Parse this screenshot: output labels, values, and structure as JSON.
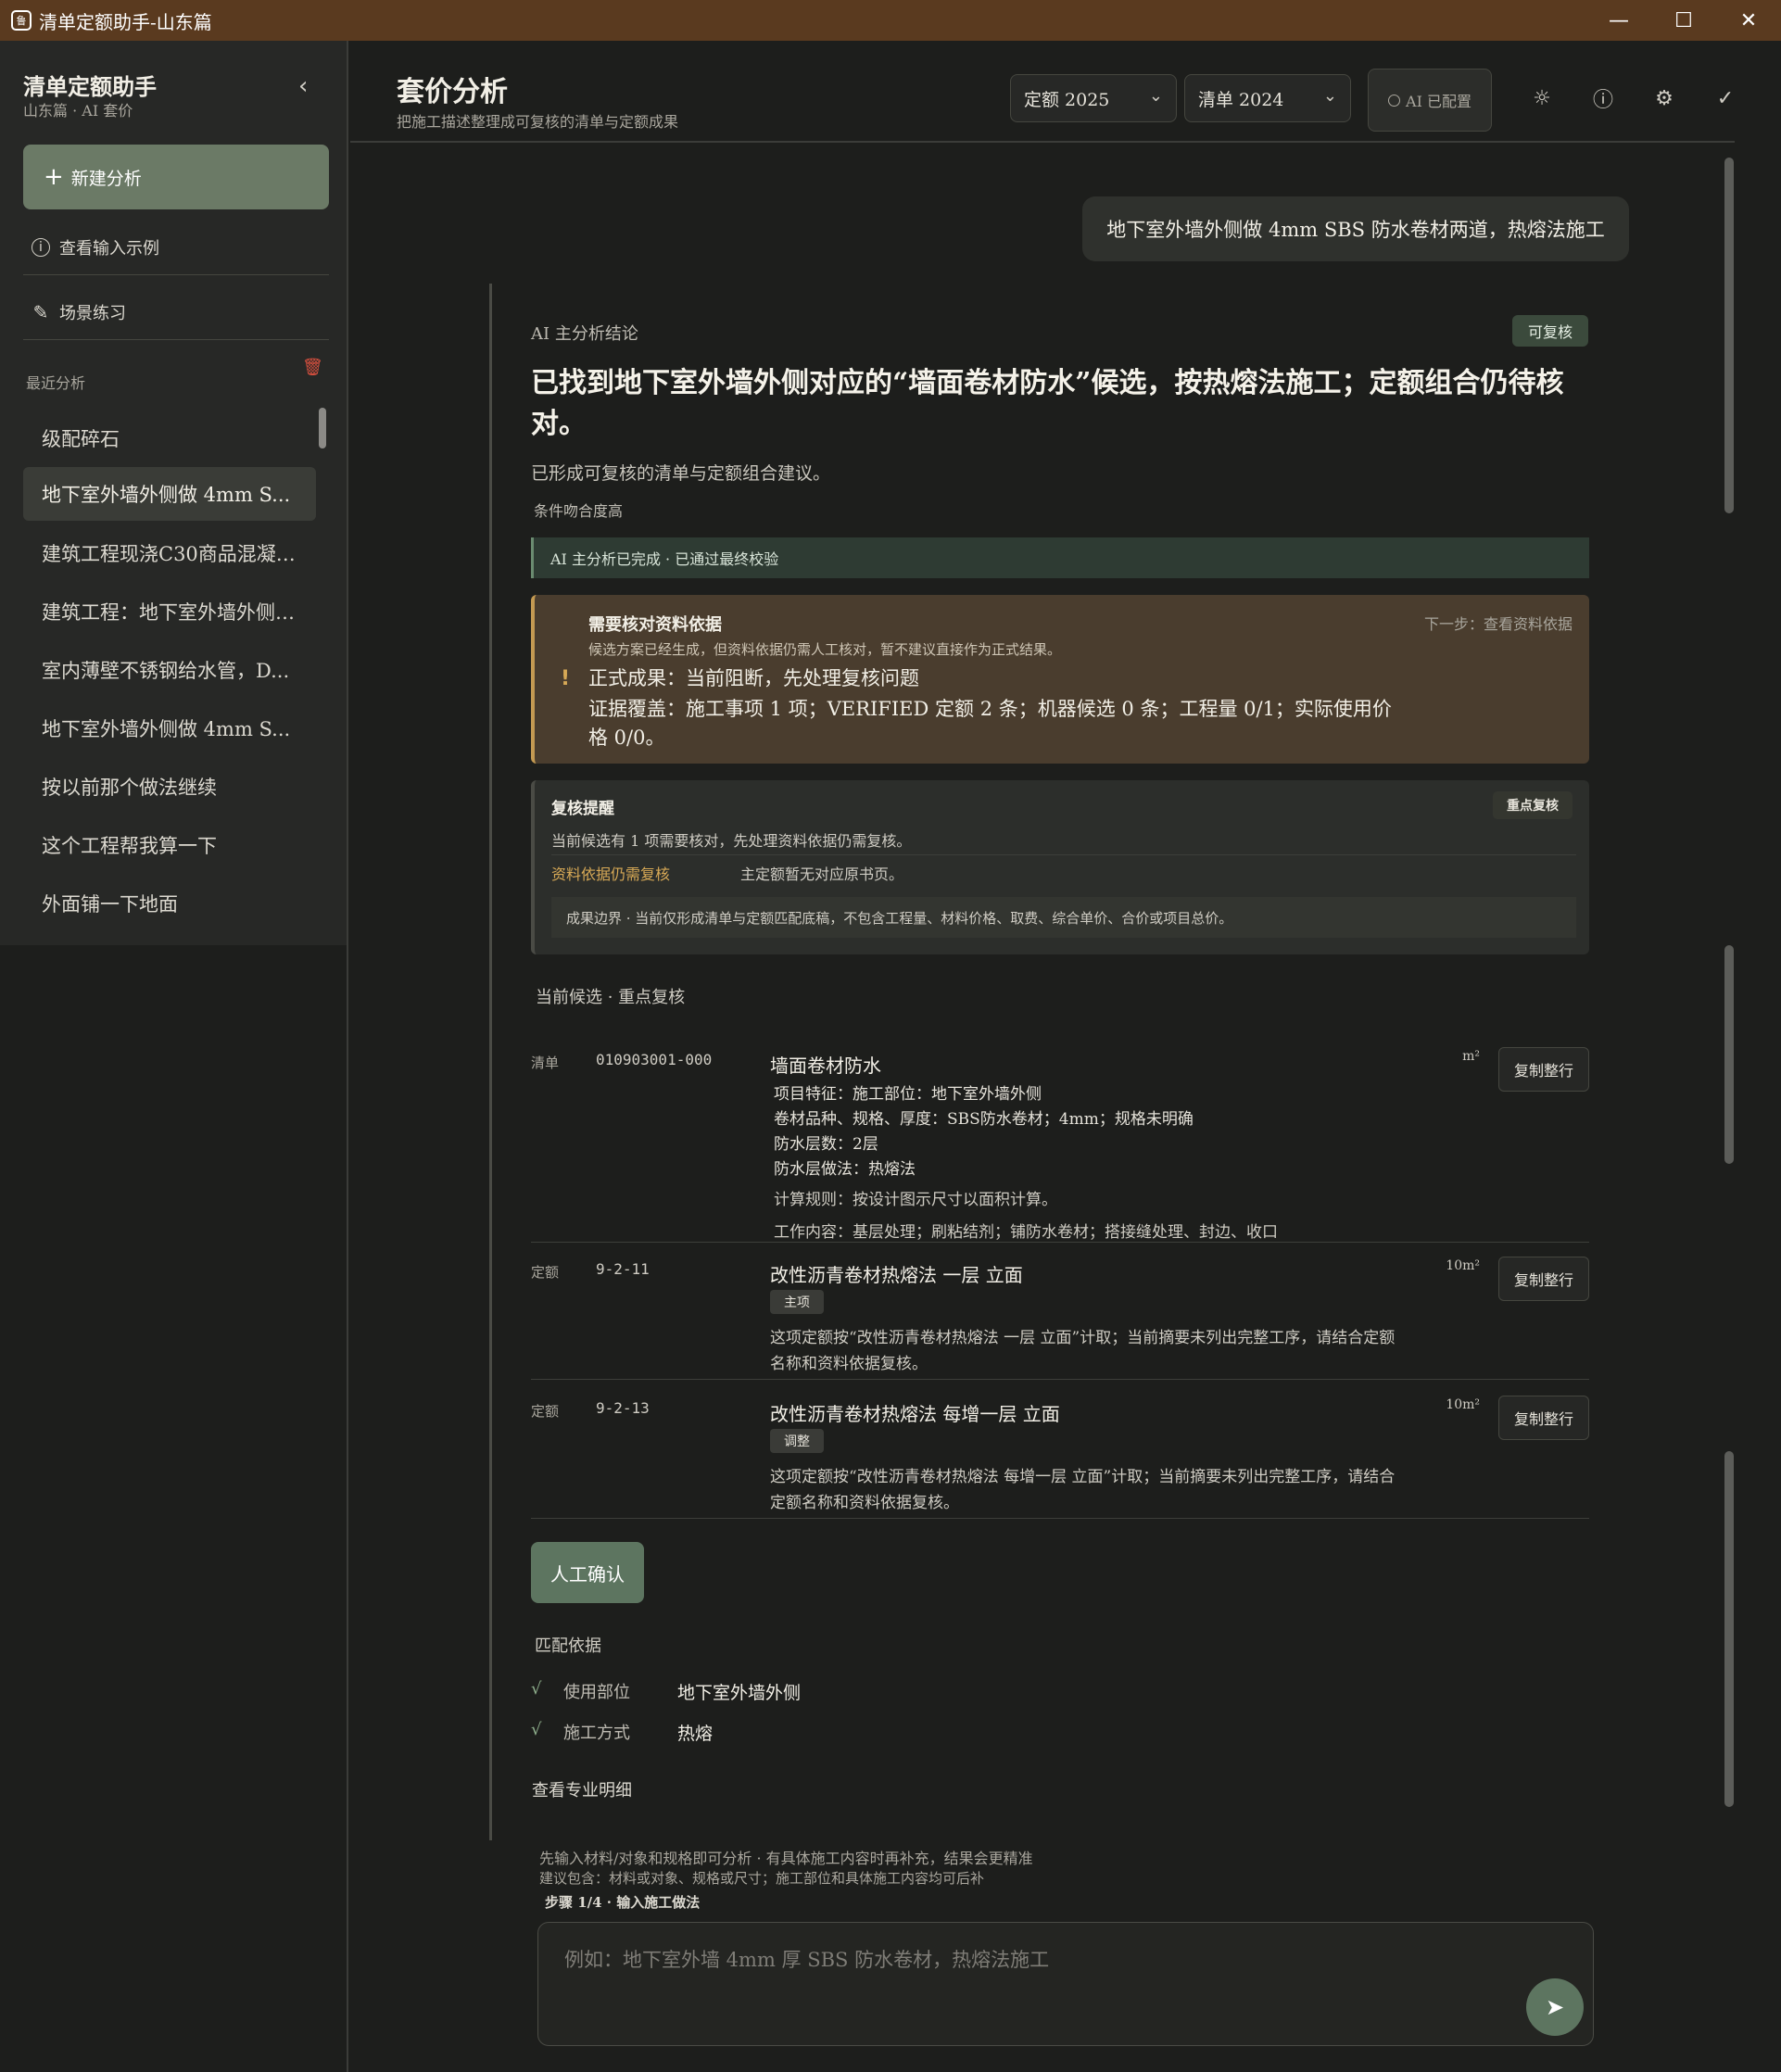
{
  "window": {
    "title": "清单定额助手-山东篇",
    "app_icon": "鲁",
    "minimize": "—",
    "maximize": "☐",
    "close": "✕"
  },
  "sidebar": {
    "brand": "清单定额助手",
    "brand_sub": "山东篇 · AI 套价",
    "collapse_icon": "‹",
    "new_button": "新建分析",
    "links": [
      "查看输入示例",
      "场景练习"
    ],
    "recent_label": "最近分析",
    "recent_items": [
      "级配碎石",
      "地下室外墙外侧做 4mm S...",
      "建筑工程现浇C30商品混凝…",
      "建筑工程：地下室外墙外侧…",
      "室内薄壁不锈钢给水管，D...",
      "地下室外墙外侧做 4mm S...",
      "按以前那个做法继续",
      "这个工程帮我算一下",
      "外面铺一下地面"
    ]
  },
  "header": {
    "title": "套价分析",
    "subtitle": "把施工描述整理成可复核的清单与定额成果",
    "quota_select": "定额 2025",
    "list_select": "清单 2024",
    "ai_status": "AI 已配置",
    "icons": [
      "sun-icon",
      "info-icon",
      "gear-icon",
      "check-icon"
    ]
  },
  "chat": {
    "user_message": "地下室外墙外侧做 4mm SBS 防水卷材两道，热熔法施工",
    "ai_label": "AI 主分析结论",
    "status_badge": "可复核",
    "conclusion": "已找到地下室外墙外侧对应的“墙面卷材防水”候选，按热熔法施工；定额组合仍待核对。",
    "conclusion_sub": "已形成可复核的清单与定额组合建议。",
    "conclusion_tag": "条件吻合度高",
    "done_bar": "AI 主分析已完成 · 已通过最终校验",
    "warning": {
      "title": "需要核对资料依据",
      "next": "下一步：查看资料依据",
      "desc": "候选方案已经生成，但资料依据仍需人工核对，暂不建议直接作为正式结果。",
      "line1": "正式成果：当前阻断，先处理复核问题",
      "line2": "证据覆盖：施工事项 1 项；VERIFIED 定额 2 条；机器候选 0 条；工程量 0/1；实际使用价格 0/0。"
    },
    "review": {
      "title": "复核提醒",
      "badge": "重点复核",
      "desc": "当前候选有 1 项需要核对，先处理资料依据仍需复核。",
      "key": "资料依据仍需复核",
      "val": "主定额暂无对应原书页。",
      "boundary": "成果边界 · 当前仅形成清单与定额匹配底稿，不包含工程量、材料价格、取费、综合单价、合价或项目总价。"
    },
    "candidates_label": "当前候选 · 重点复核",
    "list_item": {
      "kind": "清单",
      "code": "010903001-000",
      "name": "墙面卷材防水",
      "unit": "m²",
      "copy": "复制整行",
      "features": [
        "项目特征：施工部位：地下室外墙外侧",
        "卷材品种、规格、厚度：SBS防水卷材；4mm；规格未明确",
        "防水层数：2层",
        "防水层做法：热熔法"
      ],
      "calc_rule": "计算规则：按设计图示尺寸以面积计算。",
      "work": "工作内容：基层处理；刷粘结剂；铺防水卷材；搭接缝处理、封边、收口"
    },
    "quotas": [
      {
        "kind": "定额",
        "code": "9-2-11",
        "name": "改性沥青卷材热熔法 一层 立面",
        "unit": "10m²",
        "copy": "复制整行",
        "tag": "主项",
        "note": "这项定额按“改性沥青卷材热熔法 一层 立面”计取；当前摘要未列出完整工序，请结合定额名称和资料依据复核。"
      },
      {
        "kind": "定额",
        "code": "9-2-13",
        "name": "改性沥青卷材热熔法 每增一层 立面",
        "unit": "10m²",
        "copy": "复制整行",
        "tag": "调整",
        "note": "这项定额按“改性沥青卷材热熔法 每增一层 立面”计取；当前摘要未列出完整工序，请结合定额名称和资料依据复核。"
      }
    ],
    "confirm_button": "人工确认",
    "basis_label": "匹配依据",
    "basis": [
      {
        "check": "√",
        "key": "使用部位",
        "value": "地下室外墙外侧"
      },
      {
        "check": "√",
        "key": "施工方式",
        "value": "热熔"
      }
    ],
    "detail_link": "查看专业明细"
  },
  "composer": {
    "hint1": "先输入材料/对象和规格即可分析 · 有具体施工内容时再补充，结果会更精准",
    "hint2": "建议包含：材料或对象、规格或尺寸；施工部位和具体施工内容均可后补",
    "step": "步骤 1/4 · 输入施工做法",
    "placeholder": "例如：地下室外墙 4mm 厚 SBS 防水卷材，热熔法施工",
    "send_icon": "send-icon"
  }
}
